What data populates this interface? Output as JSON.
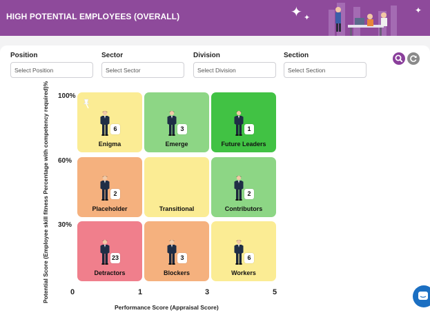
{
  "header": {
    "title": "HIGH POTENTIAL EMPLOYEES (OVERALL)",
    "sparkle_glyph": "✦"
  },
  "filters": [
    {
      "label": "Position",
      "placeholder": "Select Position"
    },
    {
      "label": "Sector",
      "placeholder": "Select Sector"
    },
    {
      "label": "Division",
      "placeholder": "Select Division"
    },
    {
      "label": "Section",
      "placeholder": "Select Section"
    }
  ],
  "buttons": {
    "search_icon": "search-icon",
    "refresh_icon": "refresh-icon"
  },
  "grid": {
    "y_axis_title": "Potential Score (Employee skill fitness Percentage with competency required)%",
    "y_ticks": [
      "100%",
      "60%",
      "30%"
    ],
    "x_axis_title": "Performance Score (Appraisal Score)",
    "x_ticks": [
      "0",
      "1",
      "3",
      "5"
    ],
    "cells": [
      {
        "label": "Enigma",
        "count": "6",
        "color": "#fbec94"
      },
      {
        "label": "Emerge",
        "count": "3",
        "color": "#8dd685"
      },
      {
        "label": "Future Leaders",
        "count": "1",
        "color": "#41c244"
      },
      {
        "label": "Placeholder",
        "count": "2",
        "color": "#f5b17e"
      },
      {
        "label": "Transitional",
        "count": "",
        "color": "#fbec94"
      },
      {
        "label": "Contributors",
        "count": "2",
        "color": "#8dd685"
      },
      {
        "label": "Detractors",
        "count": "23",
        "color": "#f07f8c"
      },
      {
        "label": "Blockers",
        "count": "3",
        "color": "#f5b17e"
      },
      {
        "label": "Workers",
        "count": "6",
        "color": "#fbec94"
      }
    ]
  },
  "colors": {
    "header": "#8e4a9b",
    "accent": "#8a3f9b",
    "chat": "#1b6fc2"
  }
}
